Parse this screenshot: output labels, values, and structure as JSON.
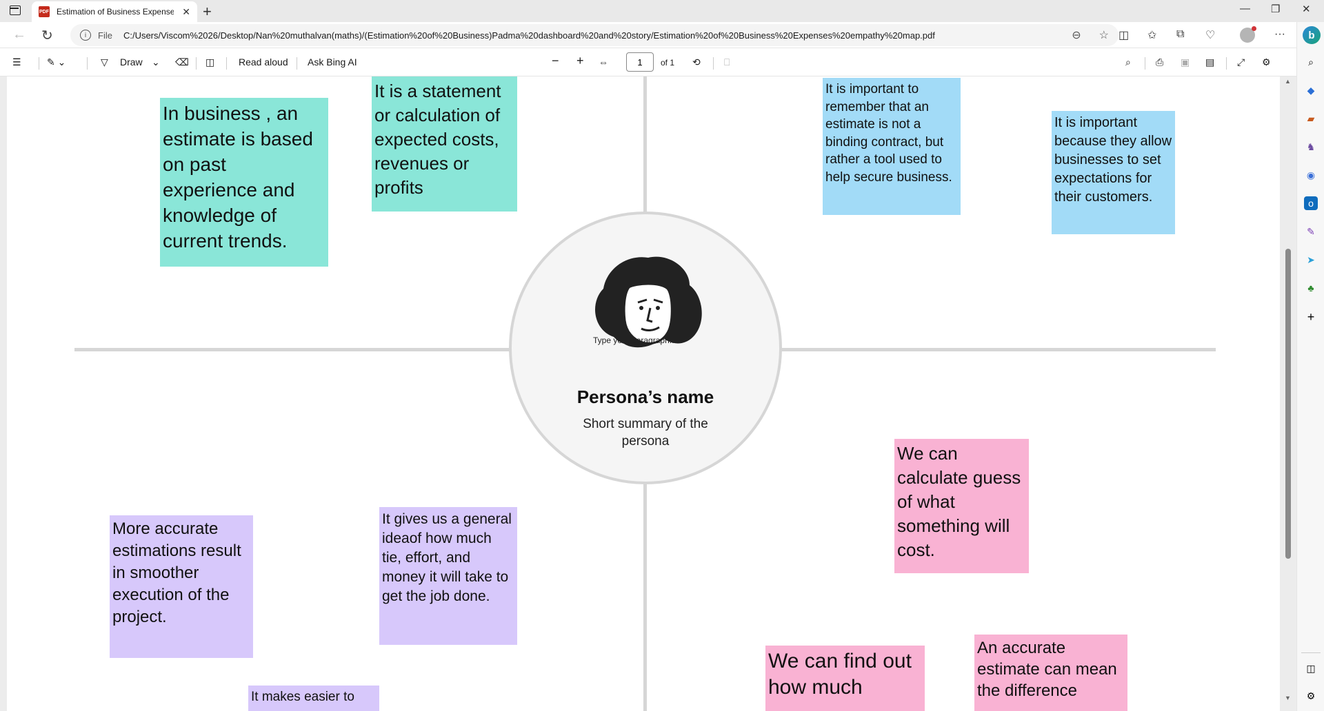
{
  "browser": {
    "tab_title": "Estimation of Business Expenses",
    "pdf_icon_label": "PDF",
    "file_label": "File",
    "url": "C:/Users/Viscom%2026/Desktop/Nan%20muthalvan(maths)/(Estimation%20of%20Business)Padma%20dashboard%20and%20story/Estimation%20of%20Business%20Expenses%20empathy%20map.pdf"
  },
  "pdf_toolbar": {
    "draw_label": "Draw",
    "read_aloud_label": "Read aloud",
    "ask_bing_label": "Ask Bing AI",
    "page_number": "1",
    "page_total": "of 1"
  },
  "persona": {
    "name": "Persona’s name",
    "summary": "Short summary of the persona",
    "placeholder": "Type your paragraph..."
  },
  "notes": {
    "says_1": "In business , an estimate is based on past experience and knowledge of current trends.",
    "says_2": "It is a statement or calculation of expected costs, revenues or profits",
    "thinks_1": "It is important to remember that an estimate is not a binding contract, but rather a tool used to help secure business.",
    "thinks_2": "It is important because they allow businesses to set expectations for their  customers.",
    "does_1": "More accurate estimations result in smoother execution of the project.",
    "does_2": "It gives us a general ideaof how much tie, effort, and money it will take to get the job done.",
    "does_3": "It makes easier to",
    "feels_1": "We can calculate guess of what something will cost.",
    "feels_2": "We can find out how much",
    "feels_3": "An accurate estimate can mean the difference"
  },
  "colors": {
    "teal": "#8ae6d8",
    "blue": "#a2dbf7",
    "purple": "#d7c8fb",
    "pink": "#f9b2d3"
  }
}
